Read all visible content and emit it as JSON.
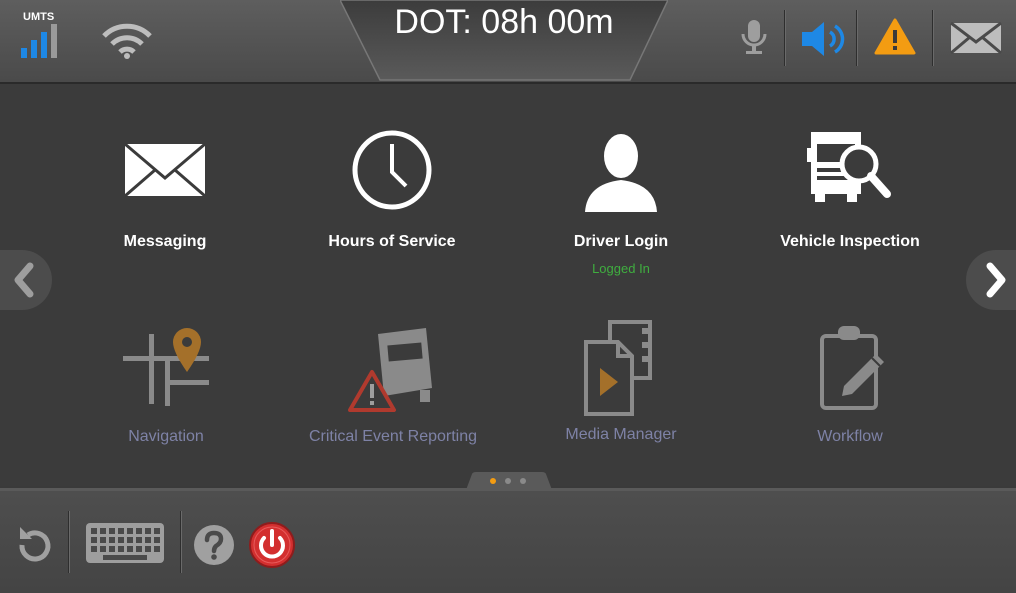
{
  "status": {
    "network_label": "UMTS",
    "dot_timer": "DOT: 08h 00m"
  },
  "apps": [
    {
      "label": "Messaging",
      "icon": "envelope-icon"
    },
    {
      "label": "Hours of Service",
      "icon": "clock-icon"
    },
    {
      "label": "Driver Login",
      "icon": "user-icon",
      "status": "Logged In"
    },
    {
      "label": "Vehicle Inspection",
      "icon": "truck-inspect-icon"
    },
    {
      "label": "Navigation",
      "icon": "map-pin-icon"
    },
    {
      "label": "Critical Event Reporting",
      "icon": "truck-warning-icon"
    },
    {
      "label": "Media Manager",
      "icon": "media-file-icon"
    },
    {
      "label": "Workflow",
      "icon": "clipboard-edit-icon"
    }
  ],
  "pager": {
    "pages": 3,
    "current": 1
  },
  "colors": {
    "accent_blue": "#1e88e5",
    "warning_orange": "#f39c12",
    "logged_in_green": "#3fae3f",
    "dim_label": "#7e82a6",
    "power_red": "#d32f2f"
  }
}
